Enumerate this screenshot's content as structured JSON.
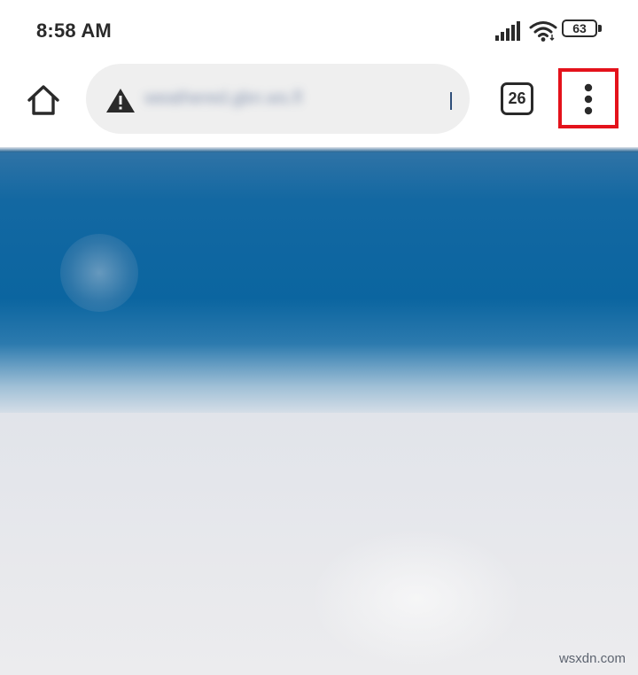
{
  "status_bar": {
    "time": "8:58 AM",
    "signal_icon": "cellular-signal-icon",
    "wifi_icon": "wifi-icon",
    "battery_icon": "battery-icon",
    "battery_level": "63"
  },
  "toolbar": {
    "home_icon": "home-icon",
    "omnibox": {
      "security_icon": "warning-icon",
      "url": "weathered.gbn.ws.fl"
    },
    "tab_count": "26",
    "menu_icon": "more-vert-icon",
    "highlight_color": "#e4121b"
  },
  "page": {
    "primary_color": "#0b65a0"
  },
  "watermark": "wsxdn.com"
}
